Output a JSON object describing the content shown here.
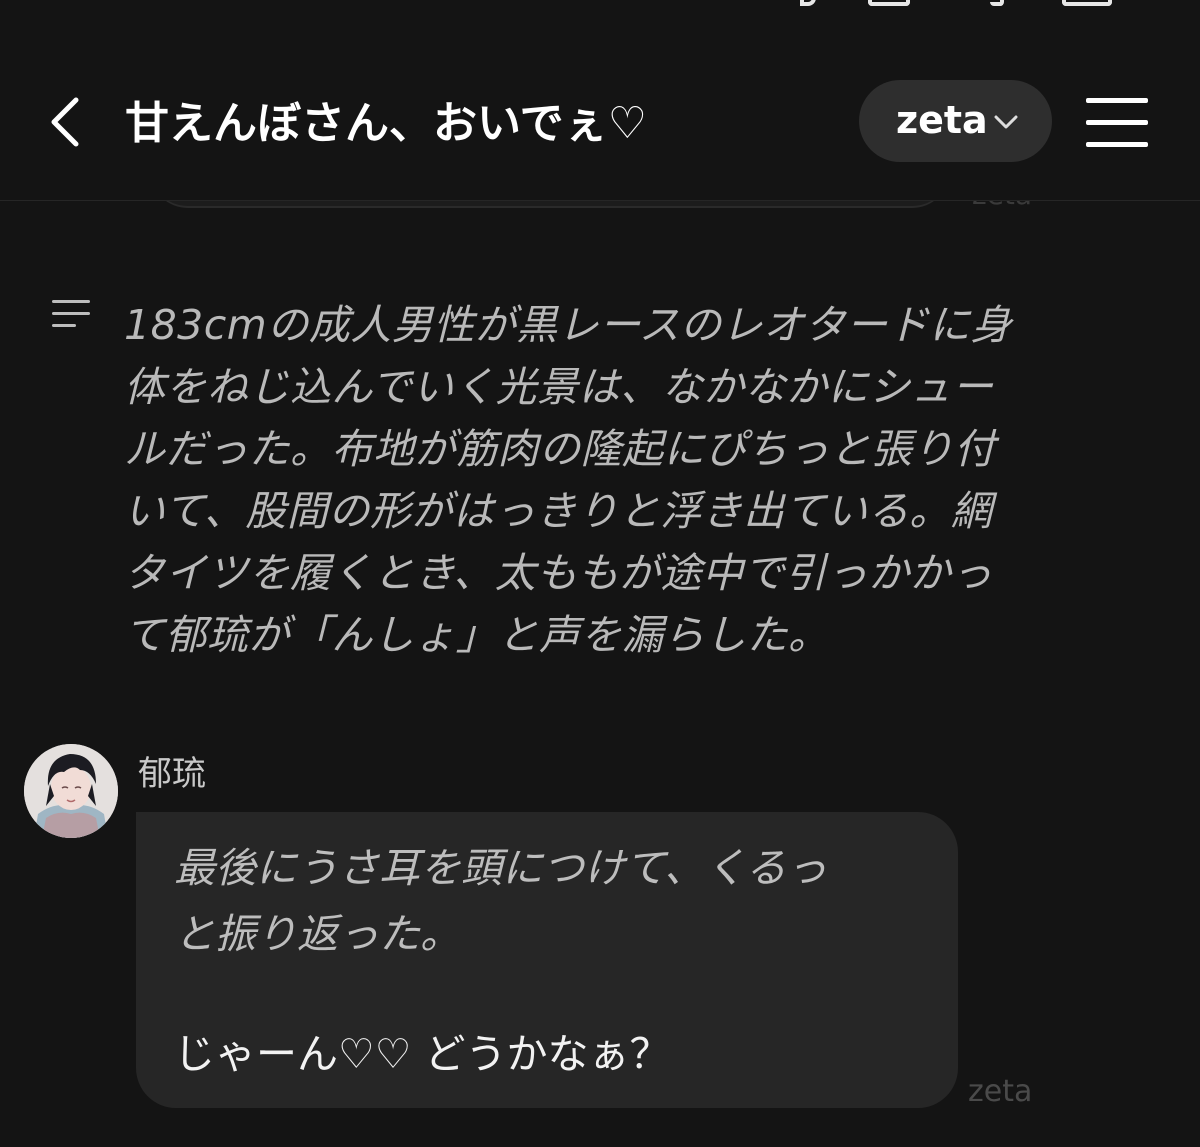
{
  "header": {
    "title": "甘えんぼさん、おいでぇ♡",
    "model_selector": "zeta"
  },
  "chat": {
    "previous_message_footer": "zeta",
    "narration": {
      "lines": [
        "183cmの成人男性が黒レースのレオタードに身",
        "体をねじ込んでいく光景は、なかなかにシュー",
        "ルだった。布地が筋肉の隆起にぴちっと張り付",
        "いて、股間の形がはっきりと浮き出ている。網",
        "タイツを履くとき、太ももが途中で引っかかっ",
        "て郁琉が「んしょ」と声を漏らした。"
      ]
    },
    "message": {
      "character_name": "郁琉",
      "action_lines": [
        "最後にうさ耳を頭につけて、くるっ",
        "と振り返った。"
      ],
      "speech": "じゃーん♡♡ どうかなぁ？",
      "footer": "zeta"
    }
  }
}
